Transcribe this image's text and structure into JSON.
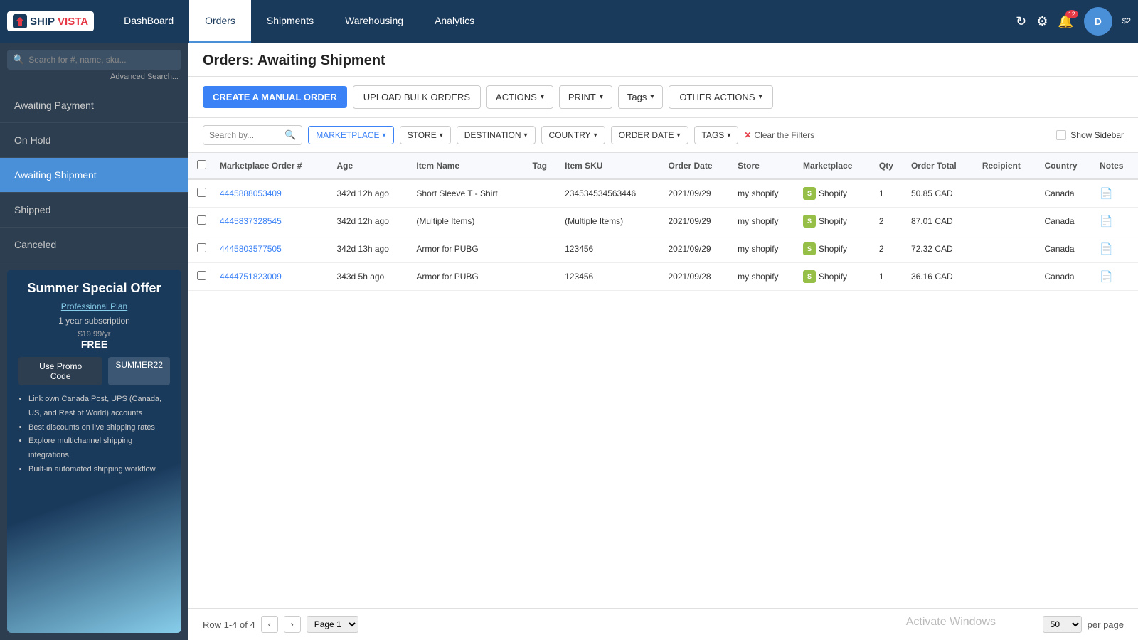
{
  "nav": {
    "logo_ship": "SHIP",
    "logo_vista": "VISTA",
    "items": [
      {
        "id": "dashboard",
        "label": "DashBoard",
        "active": false
      },
      {
        "id": "orders",
        "label": "Orders",
        "active": true
      },
      {
        "id": "shipments",
        "label": "Shipments",
        "active": false
      },
      {
        "id": "warehousing",
        "label": "Warehousing",
        "active": false
      },
      {
        "id": "analytics",
        "label": "Analytics",
        "active": false
      }
    ],
    "notif_count": "12",
    "user_initial": "D",
    "user_balance": "$2"
  },
  "sidebar": {
    "search_placeholder": "Search for #, name, sku...",
    "advanced_search": "Advanced Search...",
    "items": [
      {
        "id": "awaiting-payment",
        "label": "Awaiting Payment",
        "active": false
      },
      {
        "id": "on-hold",
        "label": "On Hold",
        "active": false
      },
      {
        "id": "awaiting-shipment",
        "label": "Awaiting Shipment",
        "active": true
      },
      {
        "id": "shipped",
        "label": "Shipped",
        "active": false
      },
      {
        "id": "canceled",
        "label": "Canceled",
        "active": false
      }
    ]
  },
  "promo": {
    "title": "Summer Special Offer",
    "plan": "Professional Plan",
    "subscription": "1 year subscription",
    "price_old": "$19.99/yr",
    "price_new": "FREE",
    "btn_label": "Use Promo Code",
    "promo_code": "SUMMER22",
    "features": [
      "Link own Canada Post, UPS (Canada, US, and Rest of World) accounts",
      "Best discounts on live shipping rates",
      "Explore multichannel shipping integrations",
      "Built-in automated shipping workflow"
    ]
  },
  "content": {
    "page_title": "Orders: Awaiting Shipment",
    "toolbar": {
      "create_btn": "CREATE A MANUAL ORDER",
      "upload_btn": "UPLOAD BULK ORDERS",
      "actions_btn": "ACTIONS",
      "print_btn": "PRINT",
      "tags_btn": "Tags",
      "other_actions_btn": "OTHER ACTIONS"
    },
    "filters": {
      "search_placeholder": "Search by...",
      "marketplace_btn": "MARKETPLACE",
      "store_btn": "STORE",
      "destination_btn": "DESTINATION",
      "country_btn": "COUNTRY",
      "order_date_btn": "ORDER DATE",
      "tags_btn": "TAGS",
      "clear_filters": "Clear the Filters",
      "show_sidebar": "Show Sidebar"
    },
    "table": {
      "headers": [
        "",
        "Marketplace Order #",
        "Age",
        "Item Name",
        "Tag",
        "Item SKU",
        "Order Date",
        "Store",
        "Marketplace",
        "Qty",
        "Order Total",
        "Recipient",
        "Country",
        "Notes"
      ],
      "rows": [
        {
          "order_num": "4445888053409",
          "age": "342d 12h ago",
          "item_name": "Short Sleeve T - Shirt",
          "tag": "",
          "sku": "234534534563446",
          "order_date": "2021/09/29",
          "store": "my shopify",
          "marketplace": "Shopify",
          "qty": "1",
          "total": "50.85 CAD",
          "recipient": "",
          "country": "Canada",
          "notes": "📄"
        },
        {
          "order_num": "4445837328545",
          "age": "342d 12h ago",
          "item_name": "(Multiple Items)",
          "tag": "",
          "sku": "(Multiple Items)",
          "order_date": "2021/09/29",
          "store": "my shopify",
          "marketplace": "Shopify",
          "qty": "2",
          "total": "87.01 CAD",
          "recipient": "",
          "country": "Canada",
          "notes": "📄"
        },
        {
          "order_num": "4445803577505",
          "age": "342d 13h ago",
          "item_name": "Armor for PUBG",
          "tag": "",
          "sku": "123456",
          "order_date": "2021/09/29",
          "store": "my shopify",
          "marketplace": "Shopify",
          "qty": "2",
          "total": "72.32 CAD",
          "recipient": "",
          "country": "Canada",
          "notes": "📄"
        },
        {
          "order_num": "4444751823009",
          "age": "343d 5h ago",
          "item_name": "Armor for PUBG",
          "tag": "",
          "sku": "123456",
          "order_date": "2021/09/28",
          "store": "my shopify",
          "marketplace": "Shopify",
          "qty": "1",
          "total": "36.16 CAD",
          "recipient": "",
          "country": "Canada",
          "notes": "📄"
        }
      ]
    },
    "pagination": {
      "row_label": "Row 1-4 of 4",
      "page_label": "Page 1",
      "per_page": "50",
      "per_page_label": "per page"
    }
  }
}
